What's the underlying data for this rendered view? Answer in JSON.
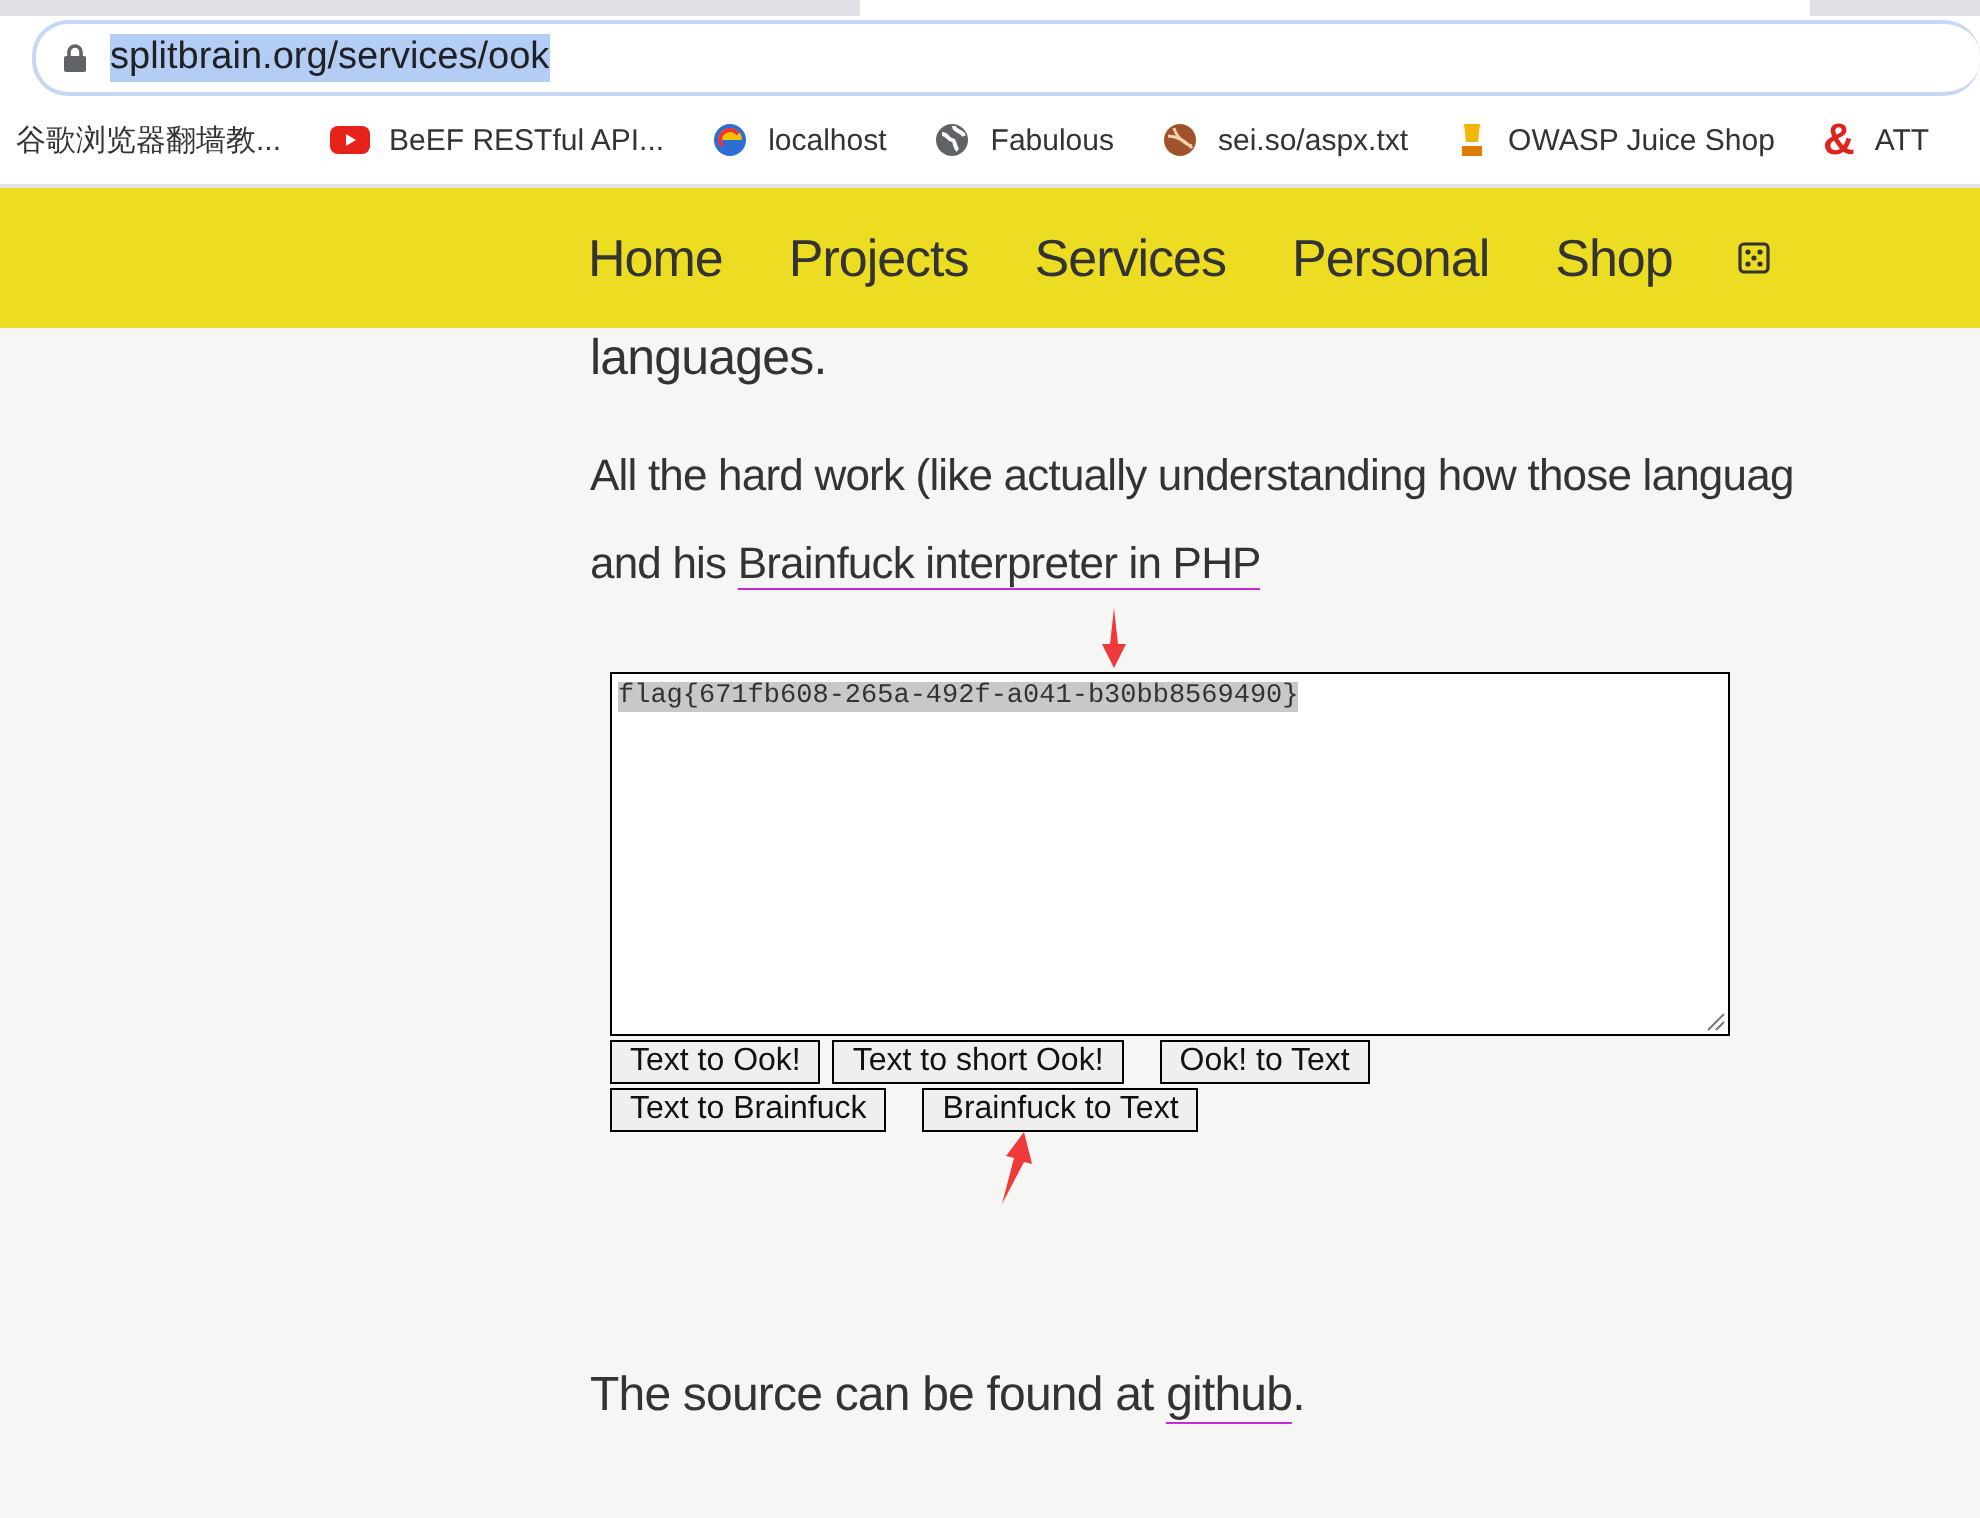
{
  "address_bar": {
    "url": "splitbrain.org/services/ook",
    "selected": true
  },
  "bookmarks": [
    {
      "label": "谷歌浏览器翻墙教...",
      "kind": "none"
    },
    {
      "label": "BeEF RESTful API...",
      "kind": "play"
    },
    {
      "label": "localhost",
      "kind": "swirl"
    },
    {
      "label": "Fabulous",
      "kind": "globe"
    },
    {
      "label": "sei.so/aspx.txt",
      "kind": "ball"
    },
    {
      "label": "OWASP Juice Shop",
      "kind": "cup"
    },
    {
      "label": "ATT",
      "kind": "glyph",
      "glyph": "&"
    }
  ],
  "nav": {
    "items": [
      "Home",
      "Projects",
      "Services",
      "Personal",
      "Shop"
    ]
  },
  "content": {
    "intro": "languages.",
    "paragraph": {
      "text": "All the hard work (like actually understanding how those languag",
      "continuation": "and his ",
      "link": "Brainfuck interpreter in PHP"
    },
    "textarea": {
      "value": "flag{671fb608-265a-492f-a041-b30bb8569490}",
      "selected": true
    },
    "button_rows": [
      [
        "Text to Ook!",
        "Text to short Ook!",
        "Ook! to Text"
      ],
      [
        "Text to Brainfuck",
        "Brainfuck to Text"
      ]
    ],
    "footer": {
      "text": "The source can be found at ",
      "link": "github",
      "after": "."
    }
  }
}
